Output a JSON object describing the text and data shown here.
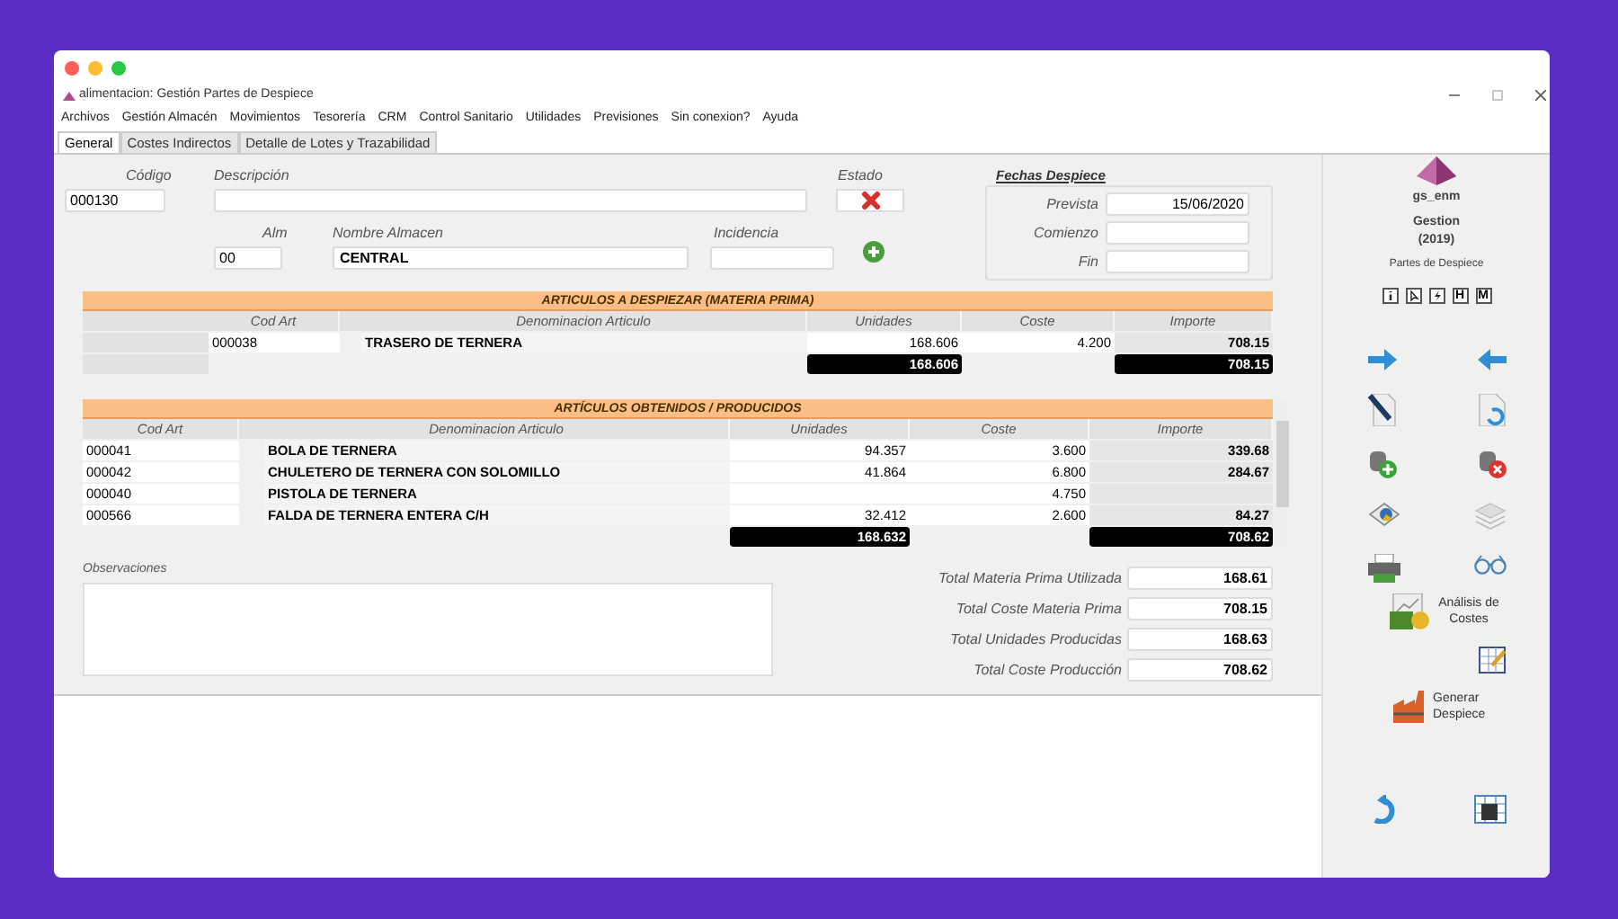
{
  "window": {
    "title": "alimentacion: Gestión Partes de Despiece"
  },
  "menu": [
    "Archivos",
    "Gestión Almacén",
    "Movimientos",
    "Tesorería",
    "CRM",
    "Control Sanitario",
    "Utilidades",
    "Previsiones",
    "Sin conexion?",
    "Ayuda"
  ],
  "tabs": [
    {
      "label": "General",
      "selected": true
    },
    {
      "label": "Costes Indirectos",
      "selected": false
    },
    {
      "label": "Detalle de Lotes y Trazabilidad",
      "selected": false
    }
  ],
  "form": {
    "codigo": {
      "label": "Código",
      "value": "000130"
    },
    "descripcion": {
      "label": "Descripción"
    },
    "estado": {
      "label": "Estado"
    },
    "alm": {
      "label": "Alm",
      "value": "00"
    },
    "nombre_almacen": {
      "label": "Nombre Almacen",
      "value": "CENTRAL"
    },
    "incidencia": {
      "label": "Incidencia"
    }
  },
  "fechas": {
    "title": "Fechas Despiece",
    "fields": [
      {
        "label": "Prevista",
        "value": "15/06/2020"
      },
      {
        "label": "Comienzo"
      },
      {
        "label": "Fin"
      }
    ]
  },
  "tables": [
    {
      "title": "ARTICULOS A DESPIEZAR (MATERIA PRIMA)",
      "columns": [
        "Cod Art",
        "Denominacion Articulo",
        "Unidades",
        "Coste",
        "Importe"
      ],
      "rows": [
        {
          "cod": "000038",
          "name": "TRASERO DE TERNERA",
          "units": "168.606",
          "cost": "4.200",
          "amount": "708.15"
        }
      ],
      "totals": {
        "units": "168.606",
        "amount": "708.15"
      }
    },
    {
      "title": "ARTÍCULOS OBTENIDOS / PRODUCIDOS",
      "columns": [
        "Cod Art",
        "Denominacion Articulo",
        "Unidades",
        "Coste",
        "Importe"
      ],
      "rows": [
        {
          "cod": "000041",
          "name": "BOLA DE TERNERA",
          "units": "94.357",
          "cost": "3.600",
          "amount": "339.68"
        },
        {
          "cod": "000042",
          "name": "CHULETERO DE TERNERA CON SOLOMILLO",
          "units": "41.864",
          "cost": "6.800",
          "amount": "284.67"
        },
        {
          "cod": "000040",
          "name": "PISTOLA DE TERNERA",
          "cost": "4.750"
        },
        {
          "cod": "000566",
          "name": "FALDA DE TERNERA ENTERA C/H",
          "units": "32.412",
          "cost": "2.600",
          "amount": "84.27"
        }
      ],
      "totals": {
        "units": "168.632",
        "amount": "708.62"
      }
    }
  ],
  "observaciones": {
    "label": "Observaciones"
  },
  "summary": [
    {
      "label": "Total Materia Prima Utilizada",
      "value": "168.61"
    },
    {
      "label": "Total Coste Materia Prima",
      "value": "708.15"
    },
    {
      "label": "Total Unidades Producidas",
      "value": "168.63"
    },
    {
      "label": "Total Coste Producción",
      "value": "708.62"
    }
  ],
  "sidebar": {
    "user": "gs_enm",
    "company": "Gestion",
    "year": "(2019)",
    "module": "Partes de Despiece",
    "letter_buttons": [
      "H",
      "M"
    ],
    "actions": [
      "Análisis de Costes",
      "Generar Despiece"
    ]
  }
}
